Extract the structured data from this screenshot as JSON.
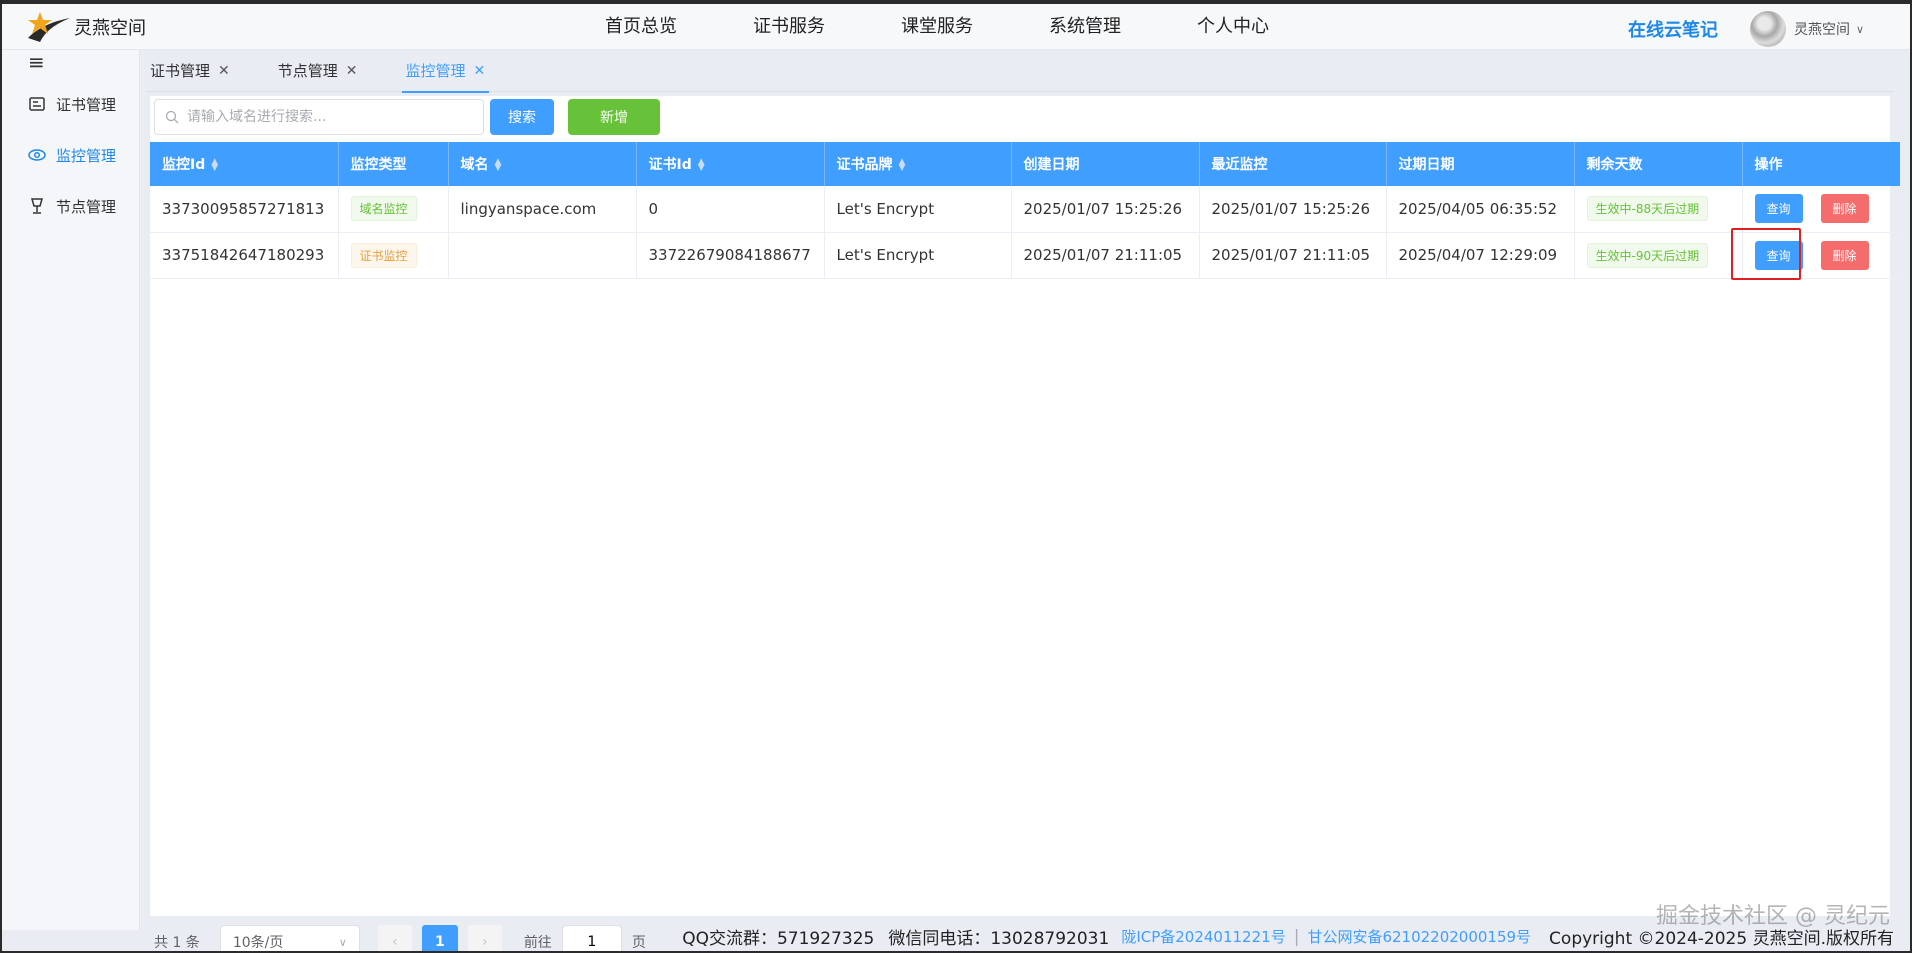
{
  "app": {
    "title": "灵燕空间",
    "cloud_note": "在线云笔记",
    "user": "灵燕空间"
  },
  "nav": [
    "首页总览",
    "证书服务",
    "课堂服务",
    "系统管理",
    "个人中心"
  ],
  "sidebar": [
    {
      "label": "证书管理",
      "icon": "certificate-icon"
    },
    {
      "label": "监控管理",
      "icon": "eye-icon"
    },
    {
      "label": "节点管理",
      "icon": "node-icon"
    }
  ],
  "tabs": [
    {
      "label": "证书管理"
    },
    {
      "label": "节点管理"
    },
    {
      "label": "监控管理"
    }
  ],
  "toolbar": {
    "search_placeholder": "请输入域名进行搜索...",
    "search_label": "搜索",
    "add_label": "新增"
  },
  "table": {
    "headers": [
      "监控Id",
      "监控类型",
      "域名",
      "证书Id",
      "证书品牌",
      "创建日期",
      "最近监控",
      "过期日期",
      "剩余天数",
      "操作"
    ],
    "rows": [
      {
        "id": "33730095857271813",
        "type": "域名监控",
        "domain": "lingyanspace.com",
        "cert_id": "0",
        "brand": "Let's Encrypt",
        "created": "2025/01/07 15:25:26",
        "last": "2025/01/07 15:25:26",
        "expire": "2025/04/05 06:35:52",
        "remain": "生效中-88天后过期"
      },
      {
        "id": "33751842647180293",
        "type": "证书监控",
        "domain": "",
        "cert_id": "33722679084188677",
        "brand": "Let's Encrypt",
        "created": "2025/01/07 21:11:05",
        "last": "2025/01/07 21:11:05",
        "expire": "2025/04/07 12:29:09",
        "remain": "生效中-90天后过期"
      }
    ],
    "query_label": "查询",
    "delete_label": "删除"
  },
  "pager": {
    "total": "共 1 条",
    "size": "10条/页",
    "current": "1",
    "goto": "前往",
    "goto_value": "1",
    "page": "页"
  },
  "footer": {
    "qq": "QQ交流群：571927325",
    "wechat": "微信同电话：13028792031",
    "icp": "陇ICP备2024011221号",
    "police": "甘公网安备62102202000159号",
    "copyright": "Copyright ©2024-2025 灵燕空间.版权所有"
  },
  "watermark": "掘金技术社区 @ 灵纪元",
  "colors": {
    "primary": "#409eff",
    "success": "#67c23a",
    "danger": "#f56c6c",
    "warning": "#e6a23c"
  }
}
